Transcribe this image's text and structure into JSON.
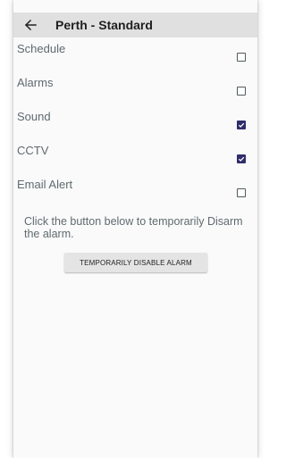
{
  "header": {
    "title": "Perth - Standard",
    "back_icon": "arrow-left-icon"
  },
  "settings": [
    {
      "label": "Schedule",
      "checked": false
    },
    {
      "label": "Alarms",
      "checked": false
    },
    {
      "label": "Sound",
      "checked": true
    },
    {
      "label": "CCTV",
      "checked": true
    },
    {
      "label": "Email Alert",
      "checked": false
    }
  ],
  "info": {
    "text": "Click the button below to temporarily Disarm the alarm."
  },
  "action": {
    "button_label": "TEMPORARILY DISABLE ALARM"
  },
  "colors": {
    "appbar": "#e0e0e0",
    "checkbox_checked": "#2f2d6a",
    "label_text": "#5f6a6f",
    "button_bg": "#e4e4e4"
  }
}
